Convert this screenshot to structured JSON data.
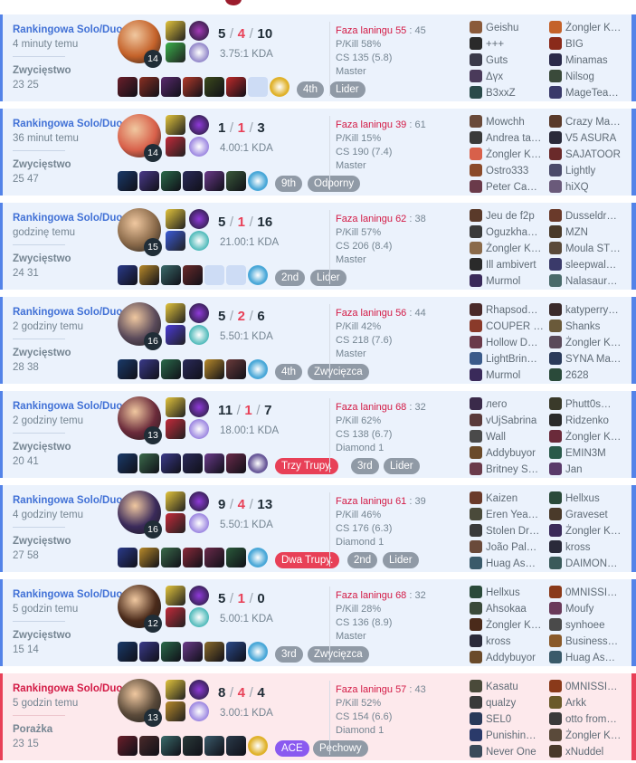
{
  "matches": [
    {
      "outcome": "win",
      "mode": "Rankingowa Solo/Duo",
      "time_ago": "4 minuty temu",
      "result": "Zwycięstwo",
      "duration": "23 25",
      "champ_level": "14",
      "champ_color": "#c4622a",
      "spells": [
        "#e2c43c",
        "#39b04a"
      ],
      "runes": [
        "#a53ab8",
        "#8f84c8"
      ],
      "kills": "5",
      "deaths": "4",
      "assists": "10",
      "kda_ratio": "3.75:1 KDA",
      "items": [
        {
          "name": "item-slot-1",
          "color": "#6a1f2a"
        },
        {
          "name": "item-slot-2",
          "color": "#8a2f22"
        },
        {
          "name": "item-slot-3",
          "color": "#5a2a6e"
        },
        {
          "name": "item-slot-4",
          "color": "#b33a2a"
        },
        {
          "name": "item-slot-5",
          "color": "#3c4a1c"
        },
        {
          "name": "item-slot-6",
          "color": "#c02a2a"
        },
        {
          "name": "item-slot-empty",
          "color": ""
        },
        {
          "name": "ward-slot",
          "color": "#e0b22c"
        }
      ],
      "badges": [
        {
          "label": "4th",
          "style": "gray"
        },
        {
          "label": "Lider",
          "style": "gray"
        }
      ],
      "lane_label": "Faza laningu",
      "lane_a": "55",
      "lane_b": "45",
      "pkill": "P/Kill 58%",
      "cs": "CS 135 (5.8)",
      "rank": "Master",
      "team_left": [
        {
          "name": "Geishu",
          "color": "#8a5a3a"
        },
        {
          "name": "+++",
          "color": "#2a2a2a"
        },
        {
          "name": "Guts",
          "color": "#3a3a4a"
        },
        {
          "name": "Δүх",
          "color": "#4a3a5a"
        },
        {
          "name": "B3xxZ",
          "color": "#2a4a4a"
        }
      ],
      "team_right": [
        {
          "name": "Żongler K…",
          "color": "#c4622a"
        },
        {
          "name": "BIG",
          "color": "#8a2a1a"
        },
        {
          "name": "Minamas",
          "color": "#2a2a4a"
        },
        {
          "name": "Nilsog",
          "color": "#3a4a3a"
        },
        {
          "name": "MageTea…",
          "color": "#3a3a6a"
        }
      ]
    },
    {
      "outcome": "win",
      "mode": "Rankingowa Solo/Duo",
      "time_ago": "36 minut temu",
      "result": "Zwycięstwo",
      "duration": "25 47",
      "champ_level": "14",
      "champ_color": "#d8604a",
      "spells": [
        "#e2c43c",
        "#c42a3a"
      ],
      "runes": [
        "#8f3ad8",
        "#9a84e0"
      ],
      "kills": "1",
      "deaths": "1",
      "assists": "3",
      "kda_ratio": "4.00:1 KDA",
      "items": [
        {
          "name": "item-slot-1",
          "color": "#1a3a6a"
        },
        {
          "name": "item-slot-2",
          "color": "#4a3a8a"
        },
        {
          "name": "item-slot-3",
          "color": "#2a6a4a"
        },
        {
          "name": "item-slot-4",
          "color": "#2a2a5a"
        },
        {
          "name": "item-slot-5",
          "color": "#6a3a8a"
        },
        {
          "name": "item-slot-6",
          "color": "#3a5a3a"
        },
        {
          "name": "ward-slot",
          "color": "#4aa8d8"
        }
      ],
      "badges": [
        {
          "label": "9th",
          "style": "gray"
        },
        {
          "label": "Odporny",
          "style": "gray"
        }
      ],
      "lane_label": "Faza laningu",
      "lane_a": "39",
      "lane_b": "61",
      "pkill": "P/Kill 15%",
      "cs": "CS 190 (7.4)",
      "rank": "Master",
      "team_left": [
        {
          "name": "Mowchh",
          "color": "#6a4a3a"
        },
        {
          "name": "Andrea ta…",
          "color": "#3a3a3a"
        },
        {
          "name": "Żongler K…",
          "color": "#d8604a"
        },
        {
          "name": "Ostro333",
          "color": "#8a4a2a"
        },
        {
          "name": "Peter Ca…",
          "color": "#6a3a4a"
        }
      ],
      "team_right": [
        {
          "name": "Crazy Ma…",
          "color": "#5a3a2a"
        },
        {
          "name": "V5 ASURA",
          "color": "#2a2a3a"
        },
        {
          "name": "SAJATOOR",
          "color": "#6a2a2a"
        },
        {
          "name": "Lightly",
          "color": "#4a4a6a"
        },
        {
          "name": "hiXQ",
          "color": "#6a5a7a"
        }
      ]
    },
    {
      "outcome": "win",
      "mode": "Rankingowa Solo/Duo",
      "time_ago": "godzinę temu",
      "result": "Zwycięstwo",
      "duration": "24 31",
      "champ_level": "15",
      "champ_color": "#8a6a4a",
      "spells": [
        "#e2c43c",
        "#3a5ad8"
      ],
      "runes": [
        "#8f3ad8",
        "#4ab8b8"
      ],
      "kills": "5",
      "deaths": "1",
      "assists": "16",
      "kda_ratio": "21.00:1 KDA",
      "items": [
        {
          "name": "item-slot-1",
          "color": "#2a3a8a"
        },
        {
          "name": "item-slot-2",
          "color": "#b88a2a"
        },
        {
          "name": "item-slot-3",
          "color": "#3a6a6a"
        },
        {
          "name": "item-slot-4",
          "color": "#6a2a2a"
        },
        {
          "name": "item-slot-empty",
          "color": ""
        },
        {
          "name": "item-slot-empty",
          "color": ""
        },
        {
          "name": "ward-slot",
          "color": "#4aa8d8"
        }
      ],
      "badges": [
        {
          "label": "2nd",
          "style": "gray"
        },
        {
          "label": "Lider",
          "style": "gray"
        }
      ],
      "lane_label": "Faza laningu",
      "lane_a": "62",
      "lane_b": "38",
      "pkill": "P/Kill 57%",
      "cs": "CS 206 (8.4)",
      "rank": "Master",
      "team_left": [
        {
          "name": "Jeu de f2p",
          "color": "#5a3a2a"
        },
        {
          "name": "Oguzkha…",
          "color": "#3a3a3a"
        },
        {
          "name": "Żongler K…",
          "color": "#8a6a4a"
        },
        {
          "name": "Ill ambivert",
          "color": "#2a2a2a"
        },
        {
          "name": "Murmol",
          "color": "#3a2a5a"
        }
      ],
      "team_right": [
        {
          "name": "Dusseldr…",
          "color": "#6a3a2a"
        },
        {
          "name": "MZN",
          "color": "#4a3a2a"
        },
        {
          "name": "Moula ST…",
          "color": "#5a4a3a"
        },
        {
          "name": "sleepwal…",
          "color": "#3a3a6a"
        },
        {
          "name": "Nalasaur…",
          "color": "#4a6a6a"
        }
      ]
    },
    {
      "outcome": "win",
      "mode": "Rankingowa Solo/Duo",
      "time_ago": "2 godziny temu",
      "result": "Zwycięstwo",
      "duration": "28 38",
      "champ_level": "16",
      "champ_color": "#5a4a5a",
      "spells": [
        "#e2c43c",
        "#4a3ad8"
      ],
      "runes": [
        "#8f3ad8",
        "#4ab8b8"
      ],
      "kills": "5",
      "deaths": "2",
      "assists": "6",
      "kda_ratio": "5.50:1 KDA",
      "items": [
        {
          "name": "item-slot-1",
          "color": "#1a3a6a"
        },
        {
          "name": "item-slot-2",
          "color": "#3a3a8a"
        },
        {
          "name": "item-slot-3",
          "color": "#2a6a4a"
        },
        {
          "name": "item-slot-4",
          "color": "#2a2a5a"
        },
        {
          "name": "item-slot-5",
          "color": "#b88a2a"
        },
        {
          "name": "item-slot-6",
          "color": "#6a3a3a"
        },
        {
          "name": "ward-slot",
          "color": "#4aa8d8"
        }
      ],
      "badges": [
        {
          "label": "4th",
          "style": "gray"
        },
        {
          "label": "Zwycięzca",
          "style": "gray"
        }
      ],
      "lane_label": "Faza laningu",
      "lane_a": "56",
      "lane_b": "44",
      "pkill": "P/Kill 42%",
      "cs": "CS 218 (7.6)",
      "rank": "Master",
      "team_left": [
        {
          "name": "Rhapsod…",
          "color": "#4a2a2a"
        },
        {
          "name": "COUPER …",
          "color": "#8a3a2a"
        },
        {
          "name": "Hollow D…",
          "color": "#6a3a4a"
        },
        {
          "name": "LightBrin…",
          "color": "#3a5a8a"
        },
        {
          "name": "Murmol",
          "color": "#3a2a5a"
        }
      ],
      "team_right": [
        {
          "name": "katyperry…",
          "color": "#3a2a2a"
        },
        {
          "name": "Shanks",
          "color": "#6a5a3a"
        },
        {
          "name": "Żongler K…",
          "color": "#5a4a5a"
        },
        {
          "name": "SYNA Ma…",
          "color": "#2a3a5a"
        },
        {
          "name": "2628",
          "color": "#2a4a3a"
        }
      ]
    },
    {
      "outcome": "win",
      "mode": "Rankingowa Solo/Duo",
      "time_ago": "2 godziny temu",
      "result": "Zwycięstwo",
      "duration": "20 41",
      "champ_level": "13",
      "champ_color": "#6a2a3a",
      "spells": [
        "#e2c43c",
        "#c42a3a"
      ],
      "runes": [
        "#8f3ad8",
        "#9a84e0"
      ],
      "kills": "11",
      "deaths": "1",
      "assists": "7",
      "kda_ratio": "18.00:1 KDA",
      "items": [
        {
          "name": "item-slot-1",
          "color": "#1a3a6a"
        },
        {
          "name": "item-slot-2",
          "color": "#3a6a4a"
        },
        {
          "name": "item-slot-3",
          "color": "#3a3a8a"
        },
        {
          "name": "item-slot-4",
          "color": "#2a2a5a"
        },
        {
          "name": "item-slot-5",
          "color": "#6a3a8a"
        },
        {
          "name": "item-slot-6",
          "color": "#6a2a4a"
        },
        {
          "name": "ward-slot",
          "color": "#6a5a9a"
        }
      ],
      "badges": [
        {
          "label": "Trzy Trupy.",
          "style": "red"
        },
        {
          "label": "3rd",
          "style": "gray"
        },
        {
          "label": "Lider",
          "style": "gray"
        }
      ],
      "lane_label": "Faza laningu",
      "lane_a": "68",
      "lane_b": "32",
      "pkill": "P/Kill 62%",
      "cs": "CS 138 (6.7)",
      "rank": "Diamond 1",
      "team_left": [
        {
          "name": "лего",
          "color": "#3a2a4a"
        },
        {
          "name": "vUjSabrina",
          "color": "#5a3a3a"
        },
        {
          "name": "Wall",
          "color": "#4a4a4a"
        },
        {
          "name": "Addybuyor",
          "color": "#6a4a2a"
        },
        {
          "name": "Britney S…",
          "color": "#6a3a4a"
        }
      ],
      "team_right": [
        {
          "name": "Phutt0s…",
          "color": "#3a3a2a"
        },
        {
          "name": "Ridzenko",
          "color": "#2a2a2a"
        },
        {
          "name": "Żongler K…",
          "color": "#6a2a3a"
        },
        {
          "name": "EMIN3M",
          "color": "#2a5a4a"
        },
        {
          "name": "Jan",
          "color": "#5a3a6a"
        }
      ]
    },
    {
      "outcome": "win",
      "mode": "Rankingowa Solo/Duo",
      "time_ago": "4 godziny temu",
      "result": "Zwycięstwo",
      "duration": "27 58",
      "champ_level": "16",
      "champ_color": "#3a2a5a",
      "spells": [
        "#e2c43c",
        "#c42a3a"
      ],
      "runes": [
        "#8f3ad8",
        "#9a84e0"
      ],
      "kills": "9",
      "deaths": "4",
      "assists": "13",
      "kda_ratio": "5.50:1 KDA",
      "items": [
        {
          "name": "item-slot-1",
          "color": "#2a3a8a"
        },
        {
          "name": "item-slot-2",
          "color": "#b88a2a"
        },
        {
          "name": "item-slot-3",
          "color": "#3a6a4a"
        },
        {
          "name": "item-slot-4",
          "color": "#8a2a3a"
        },
        {
          "name": "item-slot-5",
          "color": "#6a2a4a"
        },
        {
          "name": "item-slot-6",
          "color": "#2a5a3a"
        },
        {
          "name": "ward-slot",
          "color": "#4aa8d8"
        }
      ],
      "badges": [
        {
          "label": "Dwa Trupy.",
          "style": "red"
        },
        {
          "label": "2nd",
          "style": "gray"
        },
        {
          "label": "Lider",
          "style": "gray"
        }
      ],
      "lane_label": "Faza laningu",
      "lane_a": "61",
      "lane_b": "39",
      "pkill": "P/Kill 46%",
      "cs": "CS 176 (6.3)",
      "rank": "Diamond 1",
      "team_left": [
        {
          "name": "Kaizen",
          "color": "#6a3a2a"
        },
        {
          "name": "Eren Yea…",
          "color": "#4a4a3a"
        },
        {
          "name": "Stolen Dr…",
          "color": "#3a3a3a"
        },
        {
          "name": "João Pal…",
          "color": "#6a4a3a"
        },
        {
          "name": "Huag As…",
          "color": "#3a5a6a"
        }
      ],
      "team_right": [
        {
          "name": "Hellxus",
          "color": "#2a4a3a"
        },
        {
          "name": "Graveset",
          "color": "#4a3a2a"
        },
        {
          "name": "Żongler K…",
          "color": "#3a2a5a"
        },
        {
          "name": "kross",
          "color": "#2a2a3a"
        },
        {
          "name": "DAIMON…",
          "color": "#3a5a5a"
        }
      ]
    },
    {
      "outcome": "win",
      "mode": "Rankingowa Solo/Duo",
      "time_ago": "5 godzin temu",
      "result": "Zwycięstwo",
      "duration": "15 14",
      "champ_level": "12",
      "champ_color": "#4a2a1a",
      "spells": [
        "#e2c43c",
        "#c42a3a"
      ],
      "runes": [
        "#8f3ad8",
        "#4ab8b8"
      ],
      "kills": "5",
      "deaths": "1",
      "assists": "0",
      "kda_ratio": "5.00:1 KDA",
      "items": [
        {
          "name": "item-slot-1",
          "color": "#1a3a6a"
        },
        {
          "name": "item-slot-2",
          "color": "#3a3a8a"
        },
        {
          "name": "item-slot-3",
          "color": "#2a6a4a"
        },
        {
          "name": "item-slot-4",
          "color": "#6a3a8a"
        },
        {
          "name": "item-slot-5",
          "color": "#8a6a2a"
        },
        {
          "name": "item-slot-6",
          "color": "#2a4a8a"
        },
        {
          "name": "ward-slot",
          "color": "#4aa8d8"
        }
      ],
      "badges": [
        {
          "label": "3rd",
          "style": "gray"
        },
        {
          "label": "Zwycięzca",
          "style": "gray"
        }
      ],
      "lane_label": "Faza laningu",
      "lane_a": "68",
      "lane_b": "32",
      "pkill": "P/Kill 28%",
      "cs": "CS 136 (8.9)",
      "rank": "Master",
      "team_left": [
        {
          "name": "Hellxus",
          "color": "#2a4a3a"
        },
        {
          "name": "Ahsokaa",
          "color": "#3a4a3a"
        },
        {
          "name": "Żongler K…",
          "color": "#4a2a1a"
        },
        {
          "name": "kross",
          "color": "#2a2a3a"
        },
        {
          "name": "Addybuyor",
          "color": "#6a4a2a"
        }
      ],
      "team_right": [
        {
          "name": "0MNISSI…",
          "color": "#8a3a1a"
        },
        {
          "name": "Moufy",
          "color": "#6a3a5a"
        },
        {
          "name": "synhoee",
          "color": "#4a4a4a"
        },
        {
          "name": "Business…",
          "color": "#8a5a2a"
        },
        {
          "name": "Huag As…",
          "color": "#3a5a6a"
        }
      ]
    },
    {
      "outcome": "loss",
      "mode": "Rankingowa Solo/Duo",
      "time_ago": "5 godzin temu",
      "result": "Porażka",
      "duration": "23 15",
      "champ_level": "13",
      "champ_color": "#5a4a3a",
      "spells": [
        "#e2c43c",
        "#b88a2a"
      ],
      "runes": [
        "#8f3ad8",
        "#9a84e0"
      ],
      "kills": "8",
      "deaths": "4",
      "assists": "4",
      "kda_ratio": "3.00:1 KDA",
      "items": [
        {
          "name": "item-slot-1",
          "color": "#6a1f2a"
        },
        {
          "name": "item-slot-2",
          "color": "#4a2a2a"
        },
        {
          "name": "item-slot-3",
          "color": "#3a6a6a"
        },
        {
          "name": "item-slot-4",
          "color": "#2a3a3a"
        },
        {
          "name": "item-slot-5",
          "color": "#3a5a6a"
        },
        {
          "name": "item-slot-6",
          "color": "#2a3a4a"
        },
        {
          "name": "ward-slot",
          "color": "#e0b22c"
        }
      ],
      "badges": [
        {
          "label": "ACE",
          "style": "purple"
        },
        {
          "label": "Pechowy",
          "style": "gray"
        }
      ],
      "lane_label": "Faza laningu",
      "lane_a": "57",
      "lane_b": "43",
      "pkill": "P/Kill 52%",
      "cs": "CS 154 (6.6)",
      "rank": "Diamond 1",
      "team_left": [
        {
          "name": "Kasatu",
          "color": "#4a4a3a"
        },
        {
          "name": "qualzy",
          "color": "#3a3a3a"
        },
        {
          "name": "SEL0",
          "color": "#2a3a5a"
        },
        {
          "name": "Punishin…",
          "color": "#2a3a6a"
        },
        {
          "name": "Never One",
          "color": "#3a4a5a"
        }
      ],
      "team_right": [
        {
          "name": "0MNISSI…",
          "color": "#8a3a1a"
        },
        {
          "name": "Arkk",
          "color": "#6a5a2a"
        },
        {
          "name": "otto from…",
          "color": "#3a3a3a"
        },
        {
          "name": "Żongler K…",
          "color": "#5a4a3a"
        },
        {
          "name": "xNuddel",
          "color": "#4a3a2a"
        }
      ]
    }
  ]
}
